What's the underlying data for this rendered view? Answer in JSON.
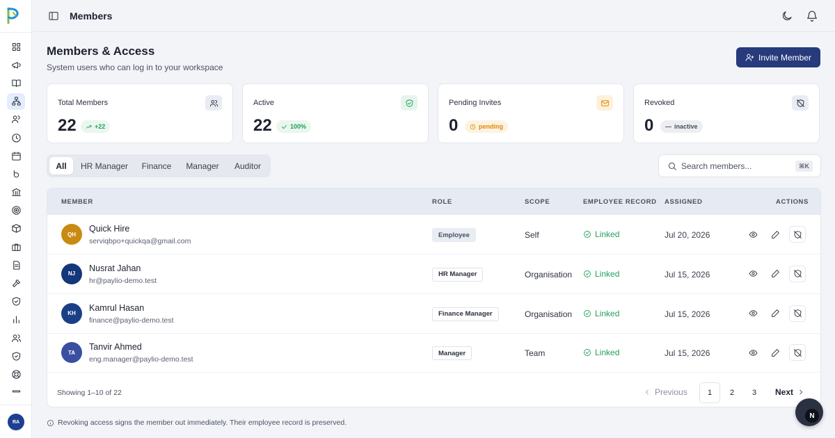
{
  "header": {
    "title": "Members"
  },
  "page": {
    "title": "Members & Access",
    "subtitle": "System users who can log in to your workspace",
    "invite_label": "Invite Member"
  },
  "sidebar": {
    "items": [
      {
        "icon": "dashboard-icon"
      },
      {
        "icon": "megaphone-icon"
      },
      {
        "icon": "book-icon"
      },
      {
        "icon": "org-chart-icon",
        "active": true
      },
      {
        "icon": "users-icon"
      },
      {
        "icon": "clock-icon"
      },
      {
        "icon": "calendar-icon"
      },
      {
        "icon": "bkash-icon"
      },
      {
        "icon": "bank-icon"
      },
      {
        "icon": "target-icon"
      },
      {
        "icon": "box-icon"
      },
      {
        "icon": "briefcase-icon"
      },
      {
        "icon": "document-icon"
      },
      {
        "icon": "gavel-icon"
      },
      {
        "icon": "shield-check-icon"
      },
      {
        "icon": "bar-chart-icon"
      },
      {
        "icon": "team-icon"
      },
      {
        "icon": "shield-icon"
      },
      {
        "icon": "support-icon"
      },
      {
        "icon": "more-icon"
      }
    ],
    "avatar_initials": "RA"
  },
  "stats": [
    {
      "label": "Total Members",
      "value": "22",
      "chip": "+22",
      "icon": "users-icon"
    },
    {
      "label": "Active",
      "value": "22",
      "chip": "100%",
      "icon": "shield-check-icon"
    },
    {
      "label": "Pending Invites",
      "value": "0",
      "chip": "pending",
      "icon": "mail-icon"
    },
    {
      "label": "Revoked",
      "value": "0",
      "chip": "inactive",
      "icon": "shield-off-icon"
    }
  ],
  "filters": {
    "tabs": [
      "All",
      "HR Manager",
      "Finance",
      "Manager",
      "Auditor"
    ],
    "active": "All"
  },
  "search": {
    "placeholder": "Search members...",
    "shortcut": "⌘K"
  },
  "table": {
    "columns": [
      "MEMBER",
      "ROLE",
      "SCOPE",
      "EMPLOYEE RECORD",
      "ASSIGNED",
      "ACTIONS"
    ],
    "rows": [
      {
        "initials": "QH",
        "name": "Quick Hire",
        "email": "serviqbpo+quickqa@gmail.com",
        "role": "Employee",
        "scope": "Self",
        "record": "Linked",
        "assigned": "Jul 20, 2026"
      },
      {
        "initials": "NJ",
        "name": "Nusrat Jahan",
        "email": "hr@paylio-demo.test",
        "role": "HR Manager",
        "scope": "Organisation",
        "record": "Linked",
        "assigned": "Jul 15, 2026"
      },
      {
        "initials": "KH",
        "name": "Kamrul Hasan",
        "email": "finance@paylio-demo.test",
        "role": "Finance Manager",
        "scope": "Organisation",
        "record": "Linked",
        "assigned": "Jul 15, 2026"
      },
      {
        "initials": "TA",
        "name": "Tanvir Ahmed",
        "email": "eng.manager@paylio-demo.test",
        "role": "Manager",
        "scope": "Team",
        "record": "Linked",
        "assigned": "Jul 15, 2026"
      }
    ],
    "showing": "Showing 1–10 of 22",
    "pagination": {
      "previous": "Previous",
      "pages": [
        "1",
        "2",
        "3"
      ],
      "current": "1",
      "next": "Next"
    }
  },
  "notice": "Revoking access signs the member out immediately. Their employee record is preserved.",
  "fab": {
    "label": "N"
  },
  "colors": {
    "primary": "#263a7c",
    "success": "#22a05a",
    "warning": "#e08a00",
    "avatar_qh": "#c98a12",
    "avatar_nj": "#14367a",
    "avatar_kh": "#1a3f86",
    "avatar_ta": "#3a4fa0"
  }
}
